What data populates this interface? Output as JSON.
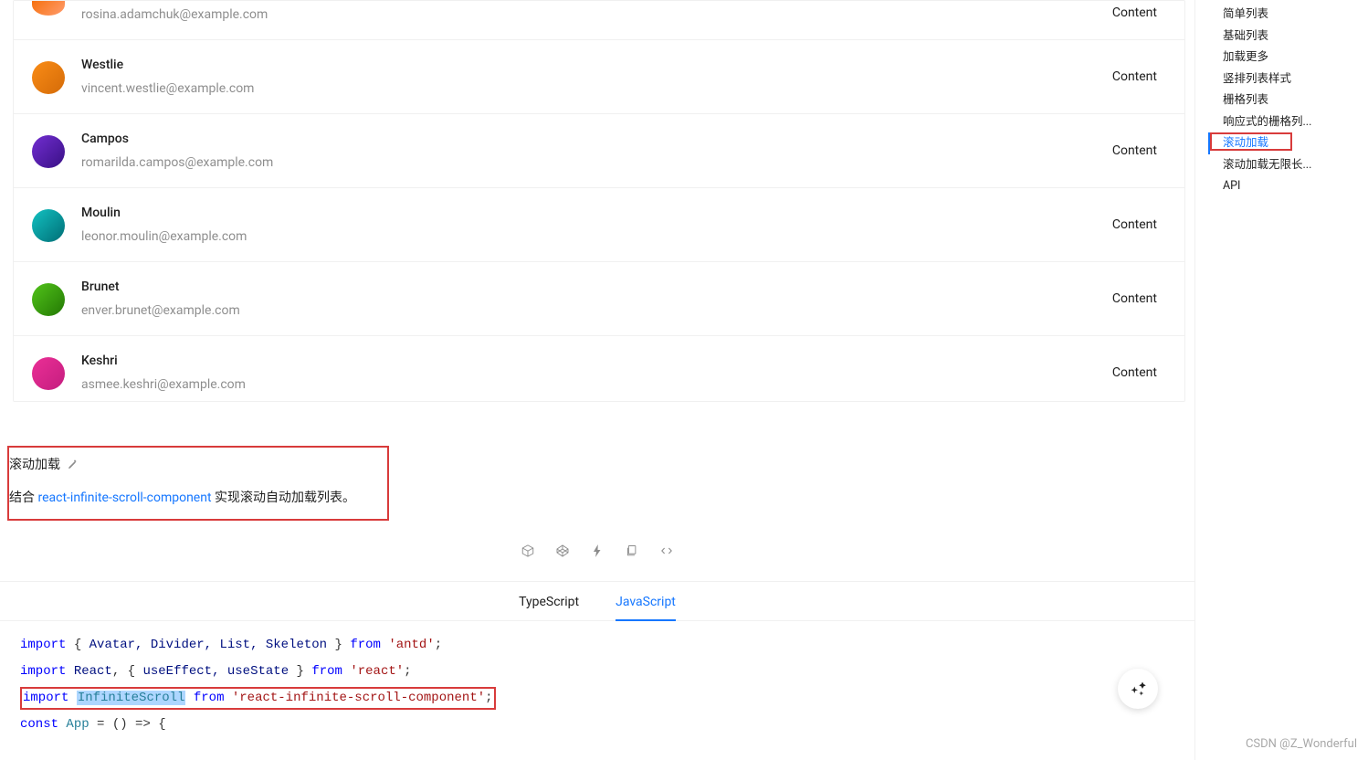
{
  "list": {
    "items": [
      {
        "name": "",
        "email": "rosina.adamchuk@example.com",
        "content": "Content"
      },
      {
        "name": "Westlie",
        "email": "vincent.westlie@example.com",
        "content": "Content"
      },
      {
        "name": "Campos",
        "email": "romarilda.campos@example.com",
        "content": "Content"
      },
      {
        "name": "Moulin",
        "email": "leonor.moulin@example.com",
        "content": "Content"
      },
      {
        "name": "Brunet",
        "email": "enver.brunet@example.com",
        "content": "Content"
      },
      {
        "name": "Keshri",
        "email": "asmee.keshri@example.com",
        "content": "Content"
      }
    ]
  },
  "desc": {
    "title": "滚动加载",
    "prefix": "结合 ",
    "link": "react-infinite-scroll-component",
    "suffix": " 实现滚动自动加载列表。"
  },
  "tabs": {
    "ts": "TypeScript",
    "js": "JavaScript"
  },
  "code": {
    "l1": {
      "import": "import",
      "braceL": "{ ",
      "ids": "Avatar, Divider, List, Skeleton",
      "braceR": " }",
      "from": "from",
      "pkg": "'antd'",
      "semi": ";"
    },
    "l2": {
      "import": "import",
      "react": "React",
      "comma": ", ",
      "braceL": "{ ",
      "ids": "useEffect, useState",
      "braceR": " }",
      "from": "from",
      "pkg": "'react'",
      "semi": ";"
    },
    "l3": {
      "import": "import",
      "cmp": "InfiniteScroll",
      "from": "from",
      "pkg": "'react-infinite-scroll-component'",
      "semi": ";"
    },
    "l4": {
      "const": "const",
      "app": "App",
      "rest": " = () => {"
    }
  },
  "anchor": {
    "items": [
      "简单列表",
      "基础列表",
      "加载更多",
      "竖排列表样式",
      "栅格列表",
      "响应式的栅格列...",
      "滚动加载",
      "滚动加载无限长...",
      "API"
    ],
    "activeIndex": 6
  },
  "watermark": "CSDN @Z_Wonderful"
}
